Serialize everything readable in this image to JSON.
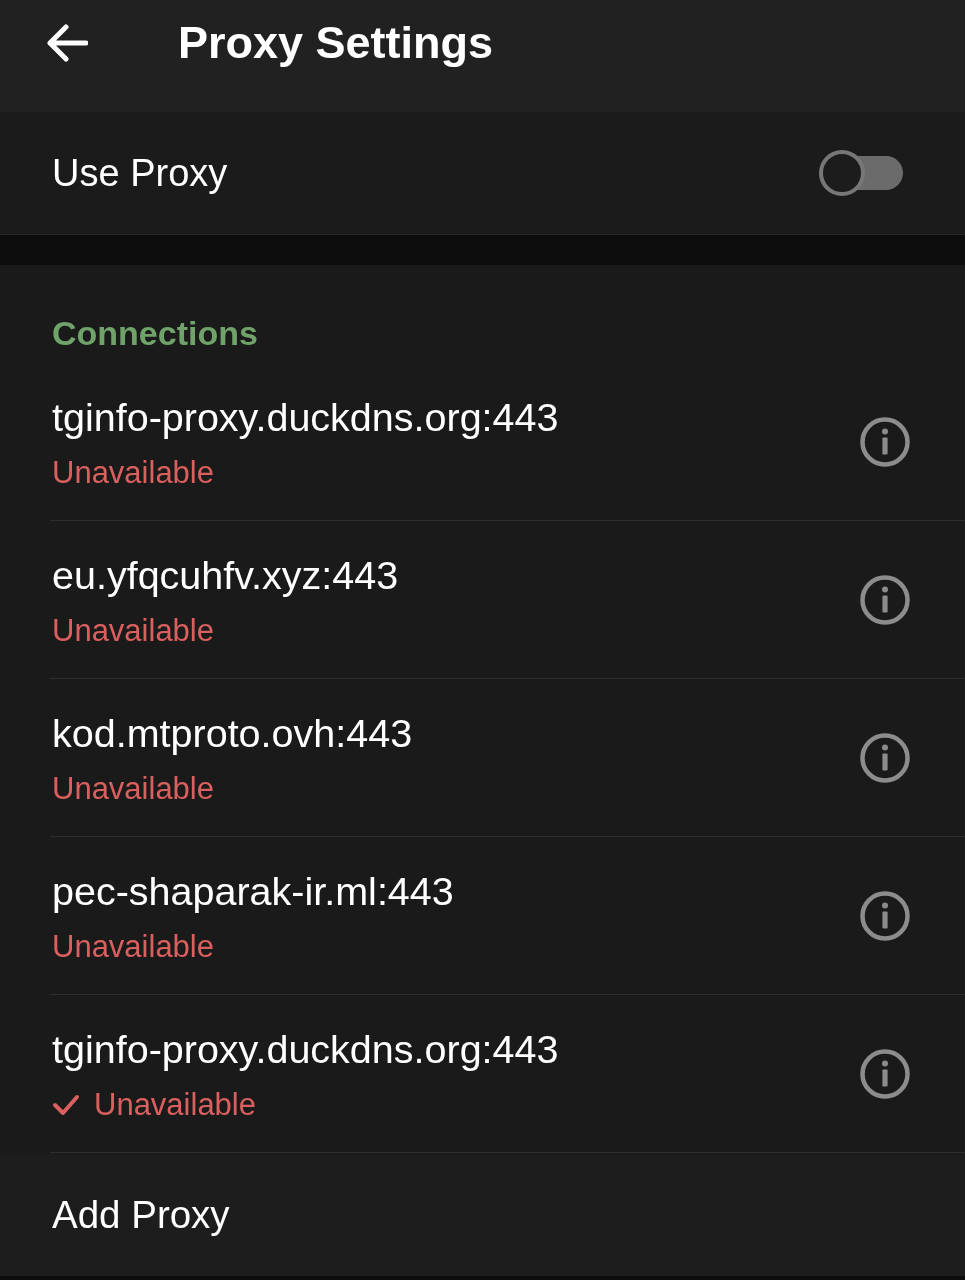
{
  "header": {
    "title": "Proxy Settings"
  },
  "use_proxy": {
    "label": "Use Proxy",
    "on": false
  },
  "connections": {
    "title": "Connections",
    "items": [
      {
        "address": "tginfo-proxy.duckdns.org:443",
        "status": "Unavailable",
        "selected": false
      },
      {
        "address": "eu.yfqcuhfv.xyz:443",
        "status": "Unavailable",
        "selected": false
      },
      {
        "address": "kod.mtproto.ovh:443",
        "status": "Unavailable",
        "selected": false
      },
      {
        "address": "pec-shaparak-ir.ml:443",
        "status": "Unavailable",
        "selected": false
      },
      {
        "address": "tginfo-proxy.duckdns.org:443",
        "status": "Unavailable",
        "selected": true
      }
    ]
  },
  "add_proxy": {
    "label": "Add Proxy"
  }
}
